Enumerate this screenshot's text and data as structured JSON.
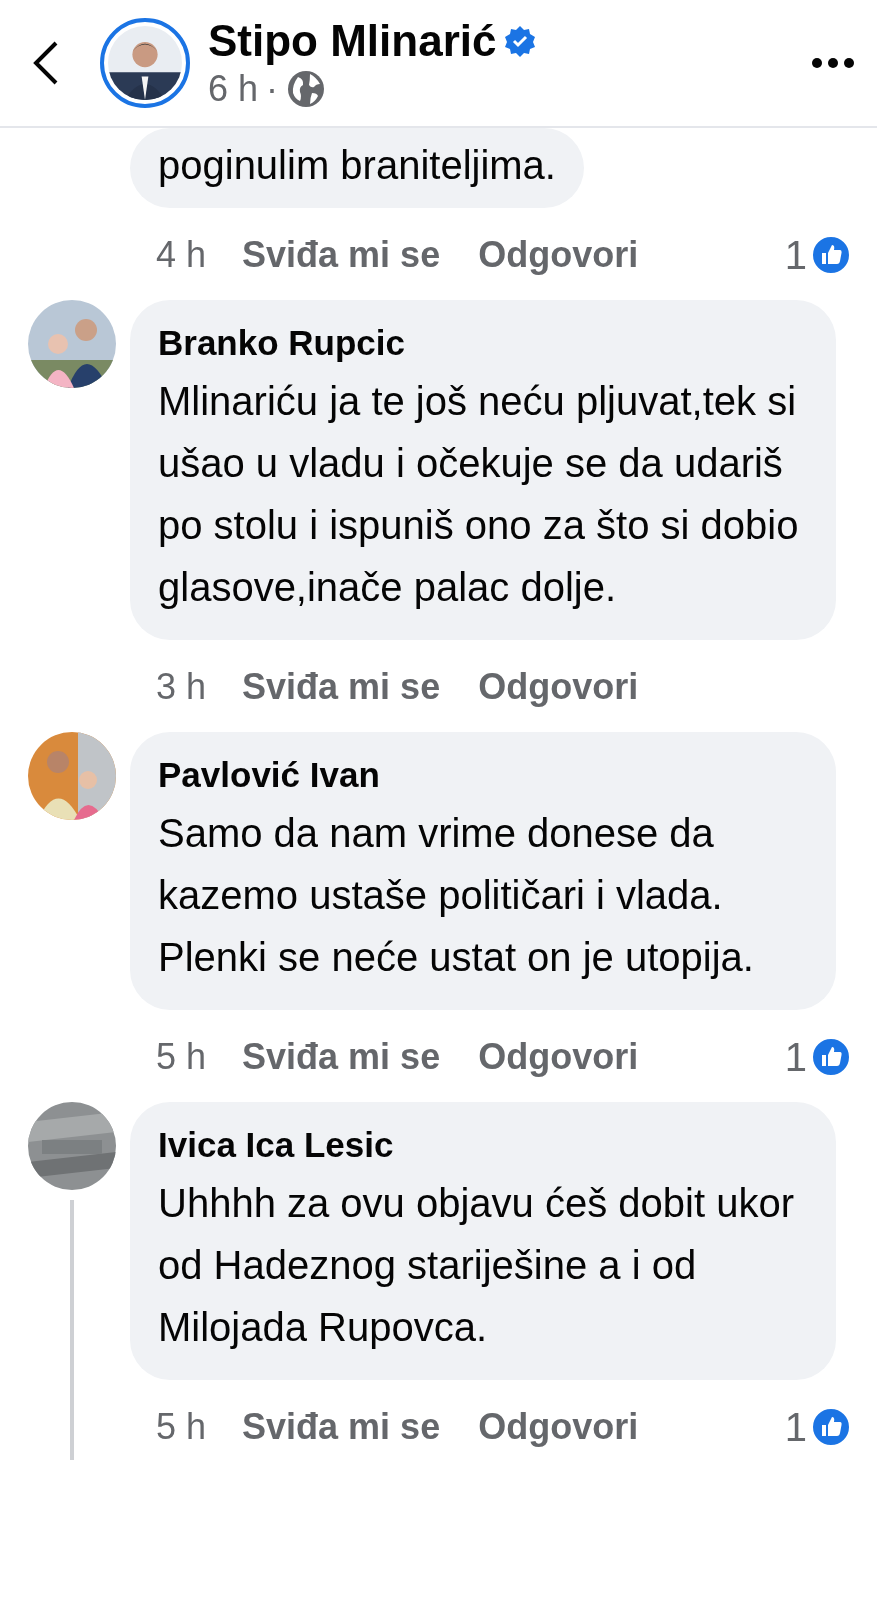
{
  "header": {
    "author": "Stipo Mlinarić",
    "verified": true,
    "time": "6 h",
    "separator": "·"
  },
  "comments": [
    {
      "text": "poginulim braniteljima.",
      "time": "4 h",
      "like_label": "Sviđa mi se",
      "reply_label": "Odgovori",
      "reaction_count": "1",
      "thread_line": false
    },
    {
      "author": "Branko Rupcic",
      "text": "Mlinariću ja te još neću pljuvat,tek si ušao u vladu i očekuje se da udariš po stolu i ispuniš ono za što si dobio glasove,inače palac dolje.",
      "time": "3 h",
      "like_label": "Sviđa mi se",
      "reply_label": "Odgovori",
      "thread_line": false
    },
    {
      "author": "Pavlović Ivan",
      "text": "Samo da nam vrime donese da kazemo ustaše političari i vlada. Plenki se neće ustat on je utopija.",
      "time": "5 h",
      "like_label": "Sviđa mi se",
      "reply_label": "Odgovori",
      "reaction_count": "1",
      "thread_line": false
    },
    {
      "author": "Ivica Ica Lesic",
      "text": "Uhhhh za ovu objavu ćeš dobit ukor od Hadeznog stariješine a i od Milojada Rupovca.",
      "time": "5 h",
      "like_label": "Sviđa mi se",
      "reply_label": "Odgovori",
      "reaction_count": "1",
      "thread_line": true
    }
  ]
}
